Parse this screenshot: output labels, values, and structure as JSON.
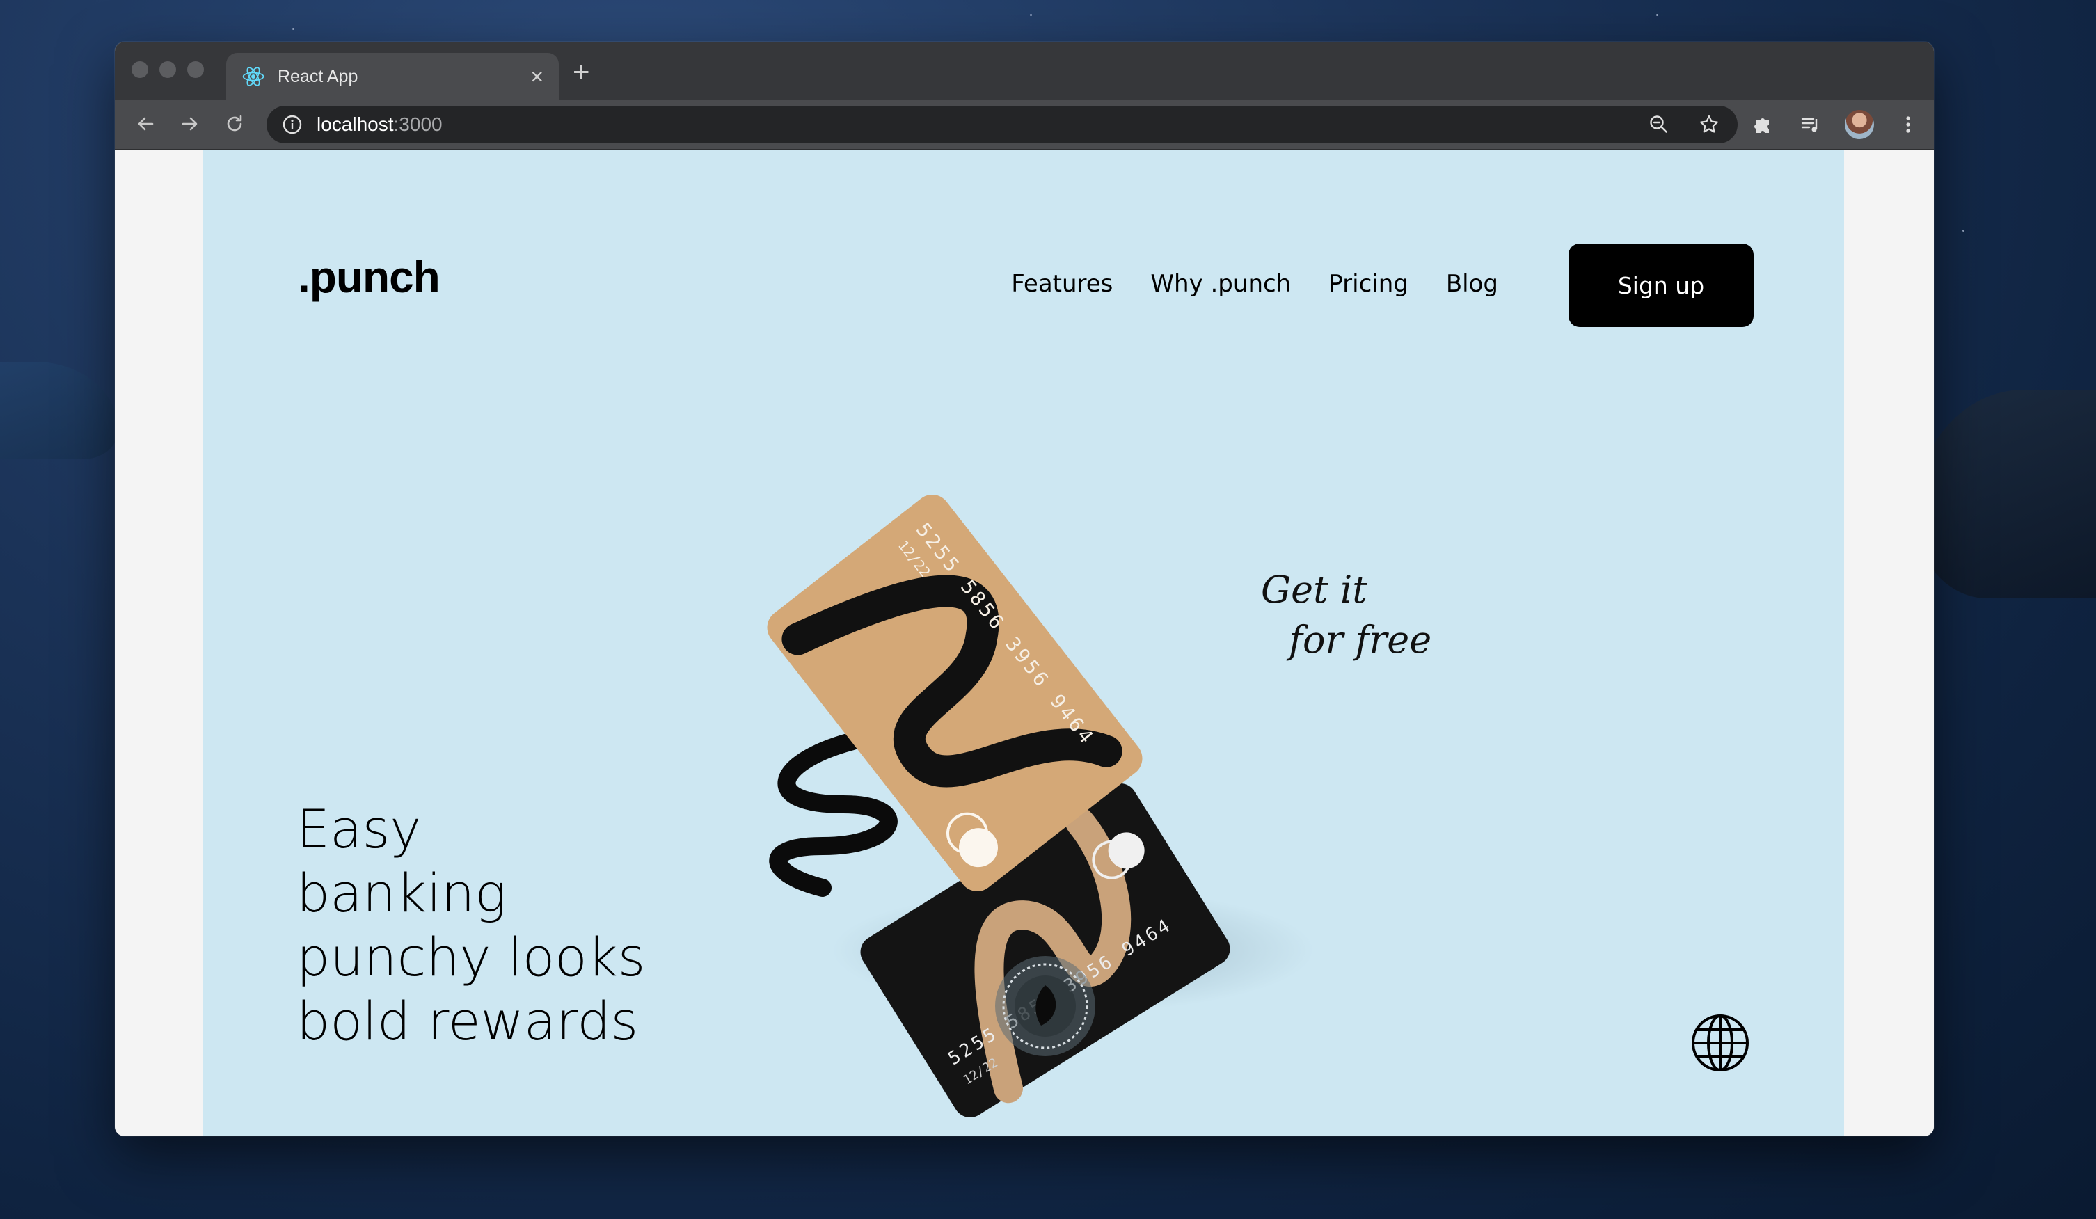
{
  "browser": {
    "tab_title": "React App",
    "url_host": "localhost",
    "url_port": ":3000",
    "icons": {
      "favicon": "react-icon",
      "back": "arrow-left-icon",
      "forward": "arrow-right-icon",
      "reload": "reload-icon",
      "site_info": "info-icon",
      "zoom": "zoom-out-icon",
      "bookmark": "star-icon",
      "extensions": "puzzle-icon",
      "media": "media-queue-icon",
      "profile": "avatar",
      "menu": "kebab-menu-icon"
    }
  },
  "page": {
    "logo": ".punch",
    "nav": [
      "Features",
      "Why .punch",
      "Pricing",
      "Blog"
    ],
    "signup_label": "Sign up",
    "hero_lines": [
      "Easy",
      "banking",
      "punchy looks",
      "bold rewards"
    ],
    "tagline_line1": "Get it",
    "tagline_line2": "for free",
    "card_front": {
      "number": "5255 5856 3956 9464",
      "expiry": "12/22"
    },
    "card_back": {
      "number": "5255 5856 3956 9464",
      "expiry": "12/22"
    },
    "colors": {
      "background": "#cde7f2",
      "card_tan": "#d4a877",
      "card_black": "#141414",
      "button": "#000000"
    }
  }
}
